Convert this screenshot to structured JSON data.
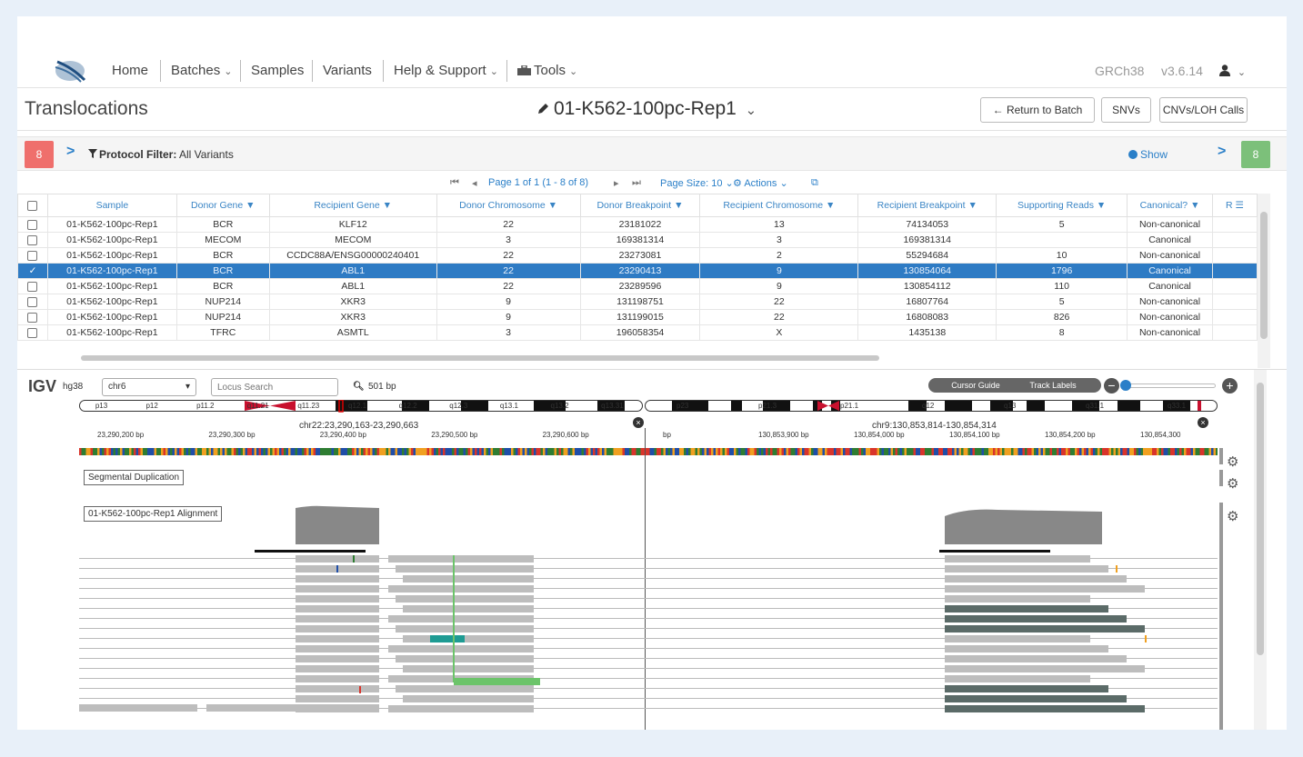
{
  "nav": {
    "items": [
      {
        "label": "Home"
      },
      {
        "label": "Batches",
        "caret": "⌄"
      },
      {
        "label": "Samples"
      },
      {
        "label": "Variants"
      },
      {
        "label": "Help & Support",
        "caret": "⌄"
      },
      {
        "label": "Tools",
        "caret": "⌄",
        "icon": "toolbox-icon"
      }
    ],
    "genome": "GRCh38",
    "version": "v3.6.14"
  },
  "title": {
    "page": "Translocations",
    "sample": "01-K562-100pc-Rep1",
    "buttons": [
      "Return to Batch",
      "SNVs",
      "CNVs/LOH Calls"
    ]
  },
  "filter": {
    "left_count": "8",
    "right_count": "8",
    "label": "Protocol Filter:",
    "value": "All Variants",
    "show": "Show",
    "colors": {
      "left": "#ef6f6c",
      "right": "#7cc07a"
    }
  },
  "pager": {
    "page_text": "Page 1 of 1 (1 - 8 of 8)",
    "page_size": "Page Size: 10",
    "actions": "Actions"
  },
  "table": {
    "columns": [
      "Sample",
      "Donor Gene",
      "Recipient Gene",
      "Donor Chromosome",
      "Donor Breakpoint",
      "Recipient Chromosome",
      "Recipient Breakpoint",
      "Supporting Reads",
      "Canonical?",
      "R"
    ],
    "rows": [
      [
        "01-K562-100pc-Rep1",
        "BCR",
        "KLF12",
        "22",
        "23181022",
        "13",
        "74134053",
        "5",
        "Non-canonical"
      ],
      [
        "01-K562-100pc-Rep1",
        "MECOM",
        "MECOM",
        "3",
        "169381314",
        "3",
        "169381314",
        "",
        "Canonical"
      ],
      [
        "01-K562-100pc-Rep1",
        "BCR",
        "CCDC88A/ENSG00000240401",
        "22",
        "23273081",
        "2",
        "55294684",
        "10",
        "Non-canonical"
      ],
      [
        "01-K562-100pc-Rep1",
        "BCR",
        "ABL1",
        "22",
        "23290413",
        "9",
        "130854064",
        "1796",
        "Canonical"
      ],
      [
        "01-K562-100pc-Rep1",
        "BCR",
        "ABL1",
        "22",
        "23289596",
        "9",
        "130854112",
        "110",
        "Canonical"
      ],
      [
        "01-K562-100pc-Rep1",
        "NUP214",
        "XKR3",
        "9",
        "131198751",
        "22",
        "16807764",
        "5",
        "Non-canonical"
      ],
      [
        "01-K562-100pc-Rep1",
        "NUP214",
        "XKR3",
        "9",
        "131199015",
        "22",
        "16808083",
        "826",
        "Non-canonical"
      ],
      [
        "01-K562-100pc-Rep1",
        "TFRC",
        "ASMTL",
        "3",
        "196058354",
        "X",
        "1435138",
        "8",
        "Non-canonical"
      ]
    ],
    "selected_row": 3
  },
  "igv": {
    "logo": "IGV",
    "genome": "hg38",
    "chromosome": "chr6",
    "locus_placeholder": "Locus Search",
    "width_label": "501 bp",
    "cursor_guide": "Cursor Guide",
    "track_labels": "Track Labels",
    "left_panel": {
      "locus": "chr22:23,290,163-23,290,663",
      "bands": [
        "p13",
        "p12",
        "p11.2",
        "q11.21",
        "q11.23",
        "q12.1",
        "q12.2",
        "q12.3",
        "q13.1",
        "q13.2",
        "q13.31"
      ],
      "ticks": [
        "23,290,200 bp",
        "23,290,300 bp",
        "23,290,400 bp",
        "23,290,500 bp",
        "23,290,600 bp"
      ]
    },
    "right_panel": {
      "locus": "chr9:130,853,814-130,854,314",
      "bands": [
        "p23",
        "p21.3",
        "p21.1",
        "q12",
        "q13",
        "q31.1",
        "q33.1"
      ],
      "ticks": [
        "bp",
        "130,853,900 bp",
        "130,854,000 bp",
        "130,854,100 bp",
        "130,854,200 bp",
        "130,854,300"
      ]
    },
    "tracks": [
      "Segmental Duplication",
      "01-K562-100pc-Rep1 Alignment"
    ]
  }
}
